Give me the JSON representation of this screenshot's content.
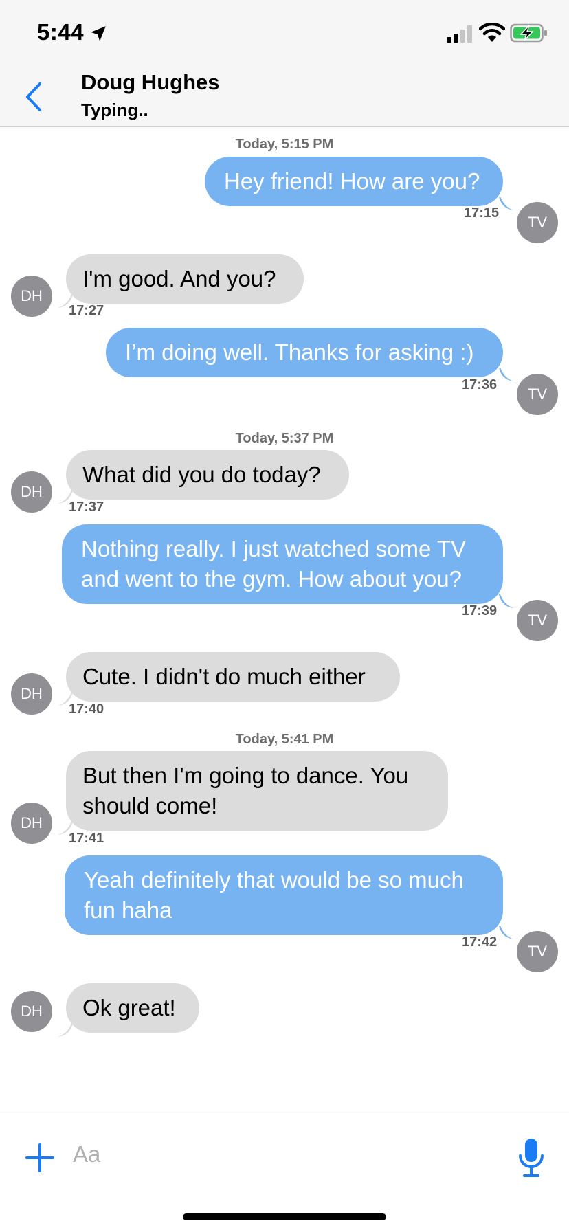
{
  "status_bar": {
    "time": "5:44"
  },
  "header": {
    "contact_name": "Doug Hughes",
    "contact_status": "Typing.."
  },
  "timestamps": [
    "Today, 5:15 PM",
    "Today, 5:37 PM",
    "Today, 5:41 PM"
  ],
  "messages": [
    {
      "direction": "out",
      "text": "Hey friend! How are you?",
      "time": "17:15",
      "avatar": "TV"
    },
    {
      "direction": "in",
      "text": "I'm good. And you?",
      "time": "17:27",
      "avatar": "DH"
    },
    {
      "direction": "out",
      "text": "I’m doing well. Thanks for asking :)",
      "time": "17:36",
      "avatar": "TV"
    },
    {
      "direction": "in",
      "text": "What did you do today?",
      "time": "17:37",
      "avatar": "DH"
    },
    {
      "direction": "out",
      "line1": "Nothing really. I just watched some TV",
      "line2": "and went to the gym. How about you?",
      "time": "17:39",
      "avatar": "TV"
    },
    {
      "direction": "in",
      "text": "Cute. I didn't do much either",
      "time": "17:40",
      "avatar": "DH"
    },
    {
      "direction": "in",
      "line1": "But then I'm going to dance. You",
      "line2": "should come!",
      "time": "17:41",
      "avatar": "DH"
    },
    {
      "direction": "out",
      "line1": "Yeah definitely that would be so much",
      "line2": "fun haha",
      "time": "17:42",
      "avatar": "TV"
    },
    {
      "direction": "in",
      "text": "Ok great!",
      "avatar": "DH"
    }
  ],
  "composer": {
    "placeholder": "Aa"
  },
  "colors": {
    "outgoing_bubble": "#77b3f0",
    "incoming_bubble": "#dcdcdc",
    "accent": "#1a7cf5",
    "avatar": "#8f8f94"
  },
  "icons": [
    "location-arrow-icon",
    "cellular-signal-icon",
    "wifi-icon",
    "battery-charging-icon",
    "back-chevron-icon",
    "plus-icon",
    "microphone-icon"
  ]
}
